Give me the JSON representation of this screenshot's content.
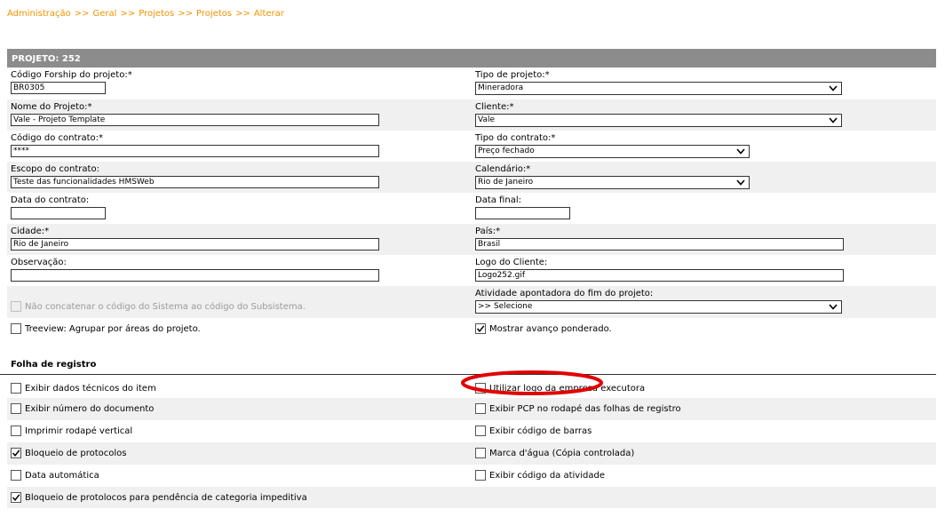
{
  "breadcrumb": {
    "items": [
      "Administração",
      "Geral",
      "Projetos",
      "Projetos",
      "Alterar"
    ],
    "separator": ">>"
  },
  "panel": {
    "title": "PROJETO: 252"
  },
  "form": {
    "codigo_forship": {
      "label": "Código Forship do projeto:*",
      "value": "BR0305"
    },
    "tipo_projeto": {
      "label": "Tipo de projeto:*",
      "value": "Mineradora"
    },
    "nome_projeto": {
      "label": "Nome do Projeto:*",
      "value": "Vale - Projeto Template"
    },
    "cliente": {
      "label": "Cliente:*",
      "value": "Vale"
    },
    "codigo_contrato": {
      "label": "Código do contrato:*",
      "value": "****"
    },
    "tipo_contrato": {
      "label": "Tipo do contrato:*",
      "value": "Preço fechado"
    },
    "escopo_contrato": {
      "label": "Escopo do contrato:",
      "value": "Teste das funcionalidades HMSWeb"
    },
    "calendario": {
      "label": "Calendário:*",
      "value": "Rio de Janeiro"
    },
    "data_contrato": {
      "label": "Data do contrato:",
      "value": ""
    },
    "data_final": {
      "label": "Data final:",
      "value": ""
    },
    "cidade": {
      "label": "Cidade:*",
      "value": "Rio de Janeiro"
    },
    "pais": {
      "label": "País:*",
      "value": "Brasil"
    },
    "observacao": {
      "label": "Observação:",
      "value": ""
    },
    "logo_cliente": {
      "label": "Logo do Cliente:",
      "value": "Logo252.gif"
    },
    "nao_concatenar": {
      "label": "Não concatenar o código do Sistema ao código do Subsistema.",
      "checked": false,
      "disabled": true
    },
    "atividade_apontadora": {
      "label": "Atividade apontadora do fim do projeto:",
      "value": ">> Selecione"
    },
    "treeview": {
      "label": "Treeview: Agrupar por áreas do projeto.",
      "checked": false
    },
    "mostrar_avanco": {
      "label": "Mostrar avanço ponderado.",
      "checked": true
    }
  },
  "folha_registro": {
    "title": "Folha de registro",
    "left": [
      {
        "label": "Exibir dados técnicos do item",
        "checked": false
      },
      {
        "label": "Exibir número do documento",
        "checked": false
      },
      {
        "label": "Imprimir rodapé vertical",
        "checked": false
      },
      {
        "label": "Bloqueio de protocolos",
        "checked": true
      },
      {
        "label": "Data automática",
        "checked": false
      },
      {
        "label": "Bloqueio de protolocos para pendência de categoria impeditiva",
        "checked": true
      }
    ],
    "right": [
      {
        "label": "Utilizar logo da empresa executora",
        "checked": false
      },
      {
        "label": "Exibir PCP no rodapé das folhas de registro",
        "checked": false
      },
      {
        "label": "Exibir código de barras",
        "checked": false
      },
      {
        "label": "Marca d'água (Cópia controlada)",
        "checked": false
      },
      {
        "label": "Exibir código da atividade",
        "checked": false
      }
    ]
  },
  "colors": {
    "breadcrumb": "#f39200",
    "header_bg": "#8c8c8c",
    "row_shade": "#f0f0f0",
    "annotation": "#e00000"
  },
  "icons": {
    "select_arrow": "chevron-down-icon",
    "checkbox_check": "check-icon"
  }
}
